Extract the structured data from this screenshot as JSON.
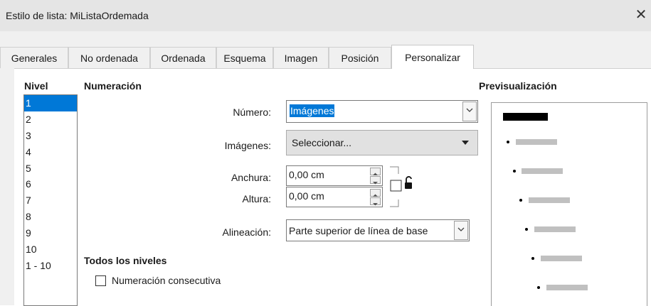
{
  "window": {
    "title": "Estilo de lista: MiListaOrdemada",
    "close_symbol": "✕"
  },
  "tabs": [
    {
      "label": "Generales"
    },
    {
      "label": "No ordenada"
    },
    {
      "label": "Ordenada"
    },
    {
      "label": "Esquema"
    },
    {
      "label": "Imagen"
    },
    {
      "label": "Posición"
    },
    {
      "label": "Personalizar",
      "active": true
    }
  ],
  "level": {
    "header": "Nivel",
    "items": [
      "1",
      "2",
      "3",
      "4",
      "5",
      "6",
      "7",
      "8",
      "9",
      "10",
      "1 - 10"
    ],
    "selected": "1"
  },
  "numbering": {
    "header": "Numeración",
    "numero_label": "Número:",
    "numero_value": "Imágenes",
    "imagenes_label": "Imágenes:",
    "imagenes_value": "Seleccionar...",
    "anchura_label": "Anchura:",
    "anchura_value": "0,00 cm",
    "altura_label": "Altura:",
    "altura_value": "0,00 cm",
    "alineacion_label": "Alineación:",
    "alineacion_value": "Parte superior de línea de base"
  },
  "all_levels": {
    "header": "Todos los niveles",
    "consecutive_label": "Numeración consecutiva",
    "consecutive_checked": false
  },
  "preview": {
    "header": "Previsualización"
  },
  "colors": {
    "selection": "#0078d7",
    "titlebar": "#e5e5e5",
    "dialog_bg": "#f0f0f0"
  }
}
